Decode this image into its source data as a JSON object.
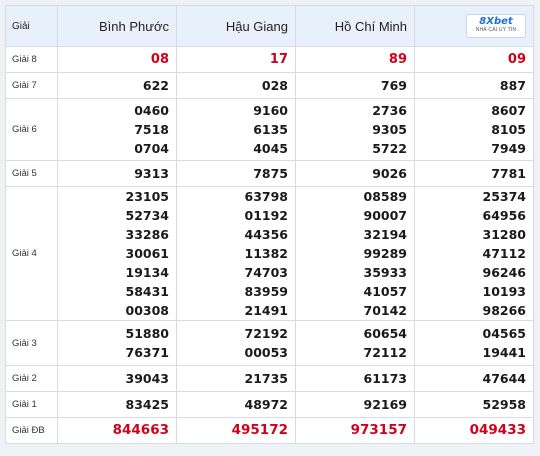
{
  "header": {
    "label": "Giải",
    "provinces": [
      "Bình Phước",
      "Hậu Giang",
      "Hồ Chí Minh"
    ],
    "logo": {
      "brand": "8Xbet",
      "tagline": "· NHÀ CÁI UY TÍN ·"
    }
  },
  "rows": [
    {
      "label": "Giải 8",
      "values": [
        [
          "08"
        ],
        [
          "17"
        ],
        [
          "89"
        ],
        [
          "09"
        ]
      ]
    },
    {
      "label": "Giải 7",
      "values": [
        [
          "622"
        ],
        [
          "028"
        ],
        [
          "769"
        ],
        [
          "887"
        ]
      ]
    },
    {
      "label": "Giải 6",
      "values": [
        [
          "0460",
          "7518",
          "0704"
        ],
        [
          "9160",
          "6135",
          "4045"
        ],
        [
          "2736",
          "9305",
          "5722"
        ],
        [
          "8607",
          "8105",
          "7949"
        ]
      ]
    },
    {
      "label": "Giải 5",
      "values": [
        [
          "9313"
        ],
        [
          "7875"
        ],
        [
          "9026"
        ],
        [
          "7781"
        ]
      ]
    },
    {
      "label": "Giải 4",
      "values": [
        [
          "23105",
          "52734",
          "33286",
          "30061",
          "19134",
          "58431",
          "00308"
        ],
        [
          "63798",
          "01192",
          "44356",
          "11382",
          "74703",
          "83959",
          "21491"
        ],
        [
          "08589",
          "90007",
          "32194",
          "99289",
          "35933",
          "41057",
          "70142"
        ],
        [
          "25374",
          "64956",
          "31280",
          "47112",
          "96246",
          "10193",
          "98266"
        ]
      ]
    },
    {
      "label": "Giải 3",
      "values": [
        [
          "51880",
          "76371"
        ],
        [
          "72192",
          "00053"
        ],
        [
          "60654",
          "72112"
        ],
        [
          "04565",
          "19441"
        ]
      ]
    },
    {
      "label": "Giải 2",
      "values": [
        [
          "39043"
        ],
        [
          "21735"
        ],
        [
          "61173"
        ],
        [
          "47644"
        ]
      ]
    },
    {
      "label": "Giải 1",
      "values": [
        [
          "83425"
        ],
        [
          "48972"
        ],
        [
          "92169"
        ],
        [
          "52958"
        ]
      ]
    },
    {
      "label": "Giải ĐB",
      "values": [
        [
          "844663"
        ],
        [
          "495172"
        ],
        [
          "973157"
        ],
        [
          "049433"
        ]
      ]
    }
  ],
  "colors": {
    "special_prize": "#d0021b",
    "header_bg": "#e8f1fb",
    "logo_blue": "#1d6fd6"
  }
}
